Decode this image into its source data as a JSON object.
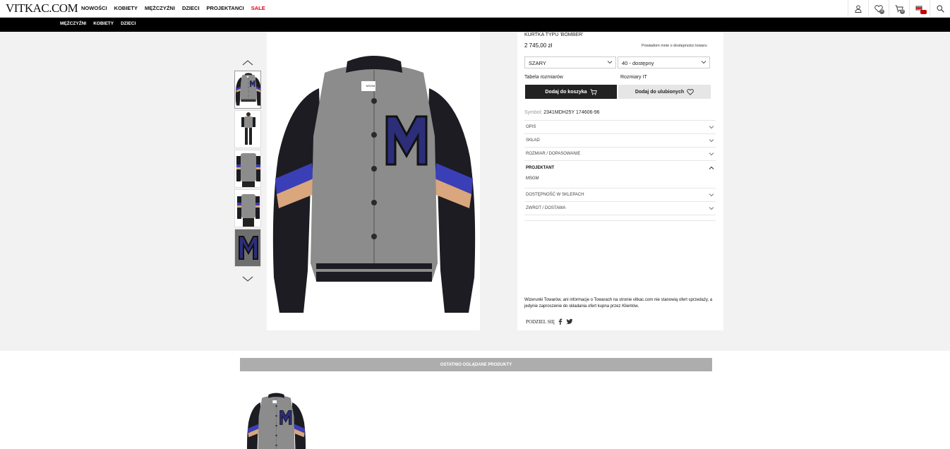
{
  "header": {
    "logo": "VITKAC.COM",
    "nav": [
      "NOWOŚCI",
      "KOBIETY",
      "MĘŻCZYŹNI",
      "DZIECI",
      "PROJEKTANCI",
      "SALE"
    ],
    "icons": [
      "user-icon",
      "heart-icon",
      "cart-icon",
      "flag-icon",
      "search-icon"
    ],
    "wishlist_count": "0",
    "cart_count": "0"
  },
  "subnav": [
    "MĘŻCZYŹNI",
    "KOBIETY",
    "DZIECI"
  ],
  "product": {
    "title": "KURTKA TYPU 'BOMBER'",
    "price": "2 745,00 zł",
    "notify": "Powiadom mnie o dostępności towaru",
    "color_select": "SZARY",
    "size_select": "40 - dostępny",
    "size_table": "Tabela rozmiarów",
    "size_system": "Rozmiary IT",
    "add_to_cart": "Dodaj do koszyka",
    "add_to_fav": "Dodaj do ulubionych",
    "symbol_label": "Symbol:",
    "symbol_value": "2341MDH25Y 174606-96",
    "accordion": [
      {
        "label": "OPIS"
      },
      {
        "label": "SKŁAD"
      },
      {
        "label": "ROZMIAR / DOPASOWANIE"
      },
      {
        "label": "PROJEKTANT",
        "content": "MSGM"
      },
      {
        "label": "DOSTĘPNOŚĆ W SKLEPACH"
      },
      {
        "label": "ZWROT / DOSTAWA"
      }
    ],
    "disclaimer": "Wizerunki Towarów, ani informacje o Towarach na stronie vitkac.com nie stanowią ofert sprzedaży, a jedynie zaproszenie do składania ofert kupna przez Klientów.",
    "share_label": "PODZIEL SIĘ",
    "brand_label": "MSGM"
  },
  "recent": {
    "title": "OSTATNIO OGLĄDANE PRODUKTY"
  },
  "colors": {
    "jacket_gray": "#8c8c8c",
    "sleeve_black": "#1c1c22",
    "stripe_blue": "#3a3fb8",
    "stripe_tan": "#d9a67d",
    "sale_red": "#e0001b"
  }
}
